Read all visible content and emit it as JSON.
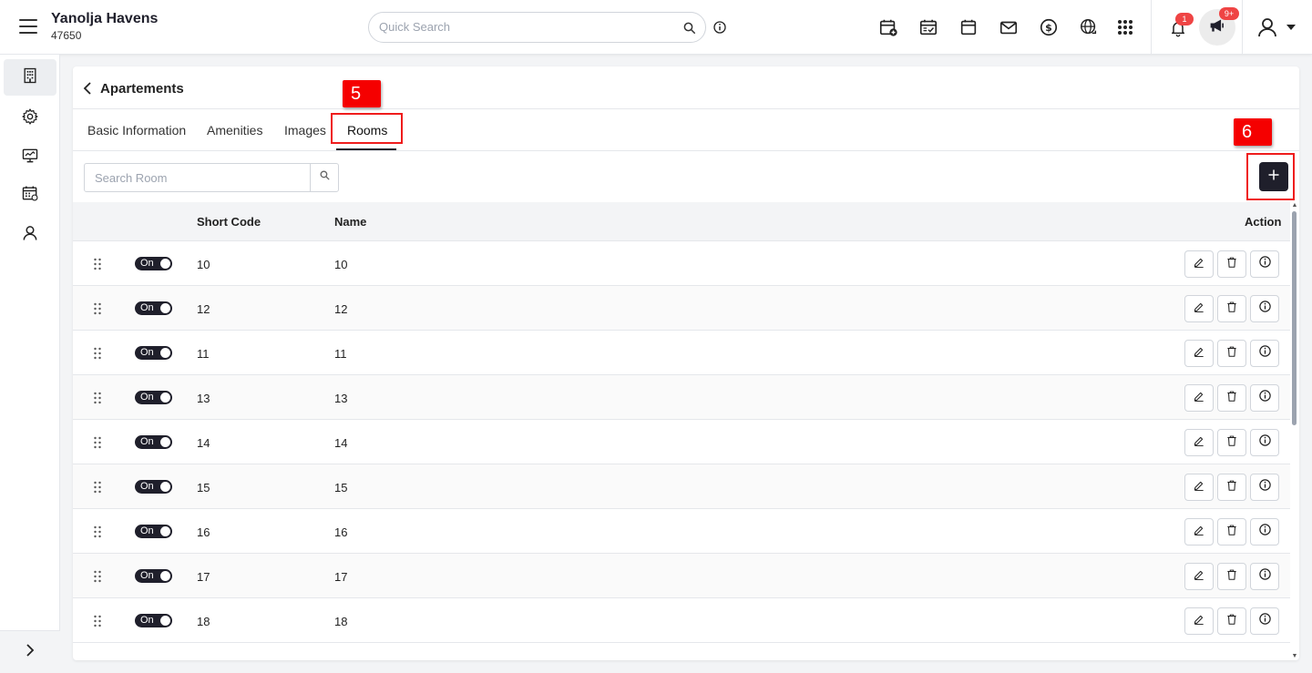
{
  "header": {
    "brand_name": "Yanolja Havens",
    "brand_id": "47650",
    "search_placeholder": "Quick Search",
    "notification_count": "1",
    "announcement_count": "9+"
  },
  "page": {
    "title": "Apartements",
    "tabs": [
      "Basic Information",
      "Amenities",
      "Images",
      "Rooms"
    ],
    "active_tab": "Rooms",
    "room_search_placeholder": "Search Room",
    "annotations": [
      "5",
      "6"
    ]
  },
  "table": {
    "headers": {
      "short_code": "Short Code",
      "name": "Name",
      "action": "Action"
    },
    "toggle_label": "On",
    "rows": [
      {
        "short_code": "10",
        "name": "10",
        "status": "On"
      },
      {
        "short_code": "12",
        "name": "12",
        "status": "On"
      },
      {
        "short_code": "11",
        "name": "11",
        "status": "On"
      },
      {
        "short_code": "13",
        "name": "13",
        "status": "On"
      },
      {
        "short_code": "14",
        "name": "14",
        "status": "On"
      },
      {
        "short_code": "15",
        "name": "15",
        "status": "On"
      },
      {
        "short_code": "16",
        "name": "16",
        "status": "On"
      },
      {
        "short_code": "17",
        "name": "17",
        "status": "On"
      },
      {
        "short_code": "18",
        "name": "18",
        "status": "On"
      }
    ]
  },
  "colors": {
    "accent": "#1f1f2b",
    "highlight": "#ef1c1c",
    "badge": "#ef4444"
  }
}
